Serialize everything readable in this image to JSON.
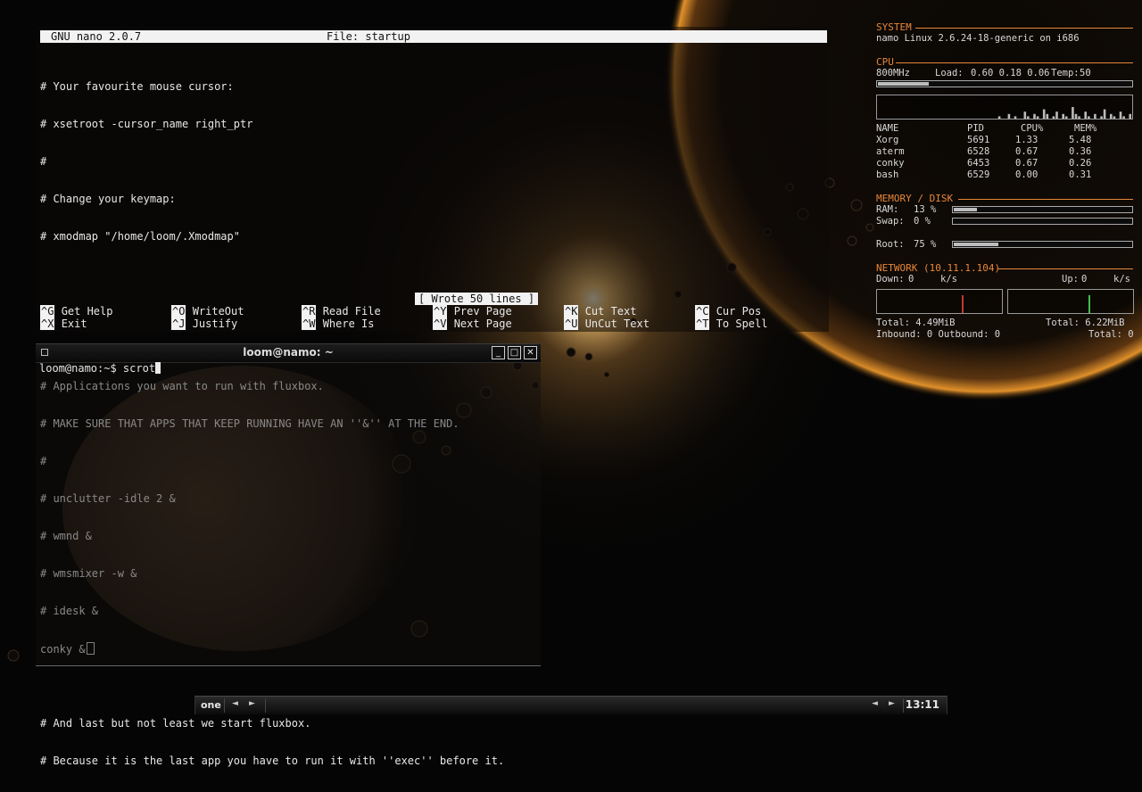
{
  "nano": {
    "version": "GNU nano 2.0.7",
    "file_title": "File: startup",
    "lines": [
      "# Your favourite mouse cursor:",
      "# xsetroot -cursor_name right_ptr",
      "#",
      "# Change your keymap:",
      "# xmodmap \"/home/loom/.Xmodmap\"",
      "",
      "",
      "",
      "# Applications you want to run with fluxbox.",
      "# MAKE SURE THAT APPS THAT KEEP RUNNING HAVE AN ''&'' AT THE END.",
      "#",
      "# unclutter -idle 2 &",
      "# wmnd &",
      "# wmsmixer -w &",
      "# idesk &",
      "conky &",
      "",
      "# And last but not least we start fluxbox.",
      "# Because it is the last app you have to run it with ''exec'' before it."
    ],
    "status_message": "[ Wrote 50 lines ]",
    "shortcuts": [
      {
        "key": "^G",
        "label": "Get Help"
      },
      {
        "key": "^O",
        "label": "WriteOut"
      },
      {
        "key": "^R",
        "label": "Read File"
      },
      {
        "key": "^Y",
        "label": "Prev Page"
      },
      {
        "key": "^K",
        "label": "Cut Text"
      },
      {
        "key": "^C",
        "label": "Cur Pos"
      },
      {
        "key": "^X",
        "label": "Exit"
      },
      {
        "key": "^J",
        "label": "Justify"
      },
      {
        "key": "^W",
        "label": "Where Is"
      },
      {
        "key": "^V",
        "label": "Next Page"
      },
      {
        "key": "^U",
        "label": "UnCut Text"
      },
      {
        "key": "^T",
        "label": "To Spell"
      }
    ]
  },
  "xterm": {
    "title": "loom@namo: ~",
    "prompt": "loom@namo:~$ ",
    "command": "scrot",
    "buttons": {
      "minimize": "_",
      "maximize": "□",
      "close": "✕"
    }
  },
  "conky": {
    "system": {
      "header": "SYSTEM",
      "info": "namo Linux 2.6.24-18-generic on i686"
    },
    "cpu": {
      "header": "CPU",
      "freq": "800MHz",
      "load_label": "Load:",
      "load_values": "0.60 0.18 0.06",
      "temp_label": "Temp:",
      "temp_value": "50",
      "usage_fraction": 0.2,
      "graph_values": [
        0,
        0,
        0,
        0,
        0,
        0,
        0,
        0,
        0,
        0,
        0,
        0,
        0,
        0,
        0,
        0,
        0,
        0,
        0,
        0,
        0,
        0,
        0,
        0,
        0,
        0,
        0,
        0,
        0,
        0,
        0,
        0,
        0,
        0,
        0,
        0,
        0,
        0,
        1,
        0,
        0,
        2,
        0,
        1,
        0,
        0,
        3,
        1,
        0,
        2,
        1,
        0,
        4,
        2,
        0,
        1,
        3,
        0,
        2,
        1,
        0,
        5,
        2,
        1,
        0,
        3,
        1,
        0,
        2,
        0,
        1,
        4,
        0,
        2,
        1,
        0,
        3,
        1,
        0,
        2
      ]
    },
    "processes": {
      "columns": [
        "NAME",
        "PID",
        "CPU%",
        "MEM%"
      ],
      "rows": [
        [
          "Xorg",
          "5691",
          "1.33",
          "5.48"
        ],
        [
          "aterm",
          "6528",
          "0.67",
          "0.36"
        ],
        [
          "conky",
          "6453",
          "0.67",
          "0.26"
        ],
        [
          "bash",
          "6529",
          "0.00",
          "0.31"
        ]
      ]
    },
    "memory": {
      "header": "MEMORY / DISK",
      "ram_label": "RAM:",
      "ram_value": "13 %",
      "ram_fraction": 0.13,
      "swap_label": "Swap:",
      "swap_value": "0 %",
      "swap_fraction": 0.0,
      "root_label": "Root:",
      "root_value": "75 %",
      "root_fraction": 0.25
    },
    "network": {
      "header": "NETWORK (10.11.1.104)",
      "down_label": "Down:",
      "down_value": "0",
      "down_unit": "k/s",
      "up_label": "Up:",
      "up_value": "0",
      "up_unit": "k/s",
      "total_down": "Total: 4.49MiB",
      "total_up": "Total: 6.22MiB",
      "inbound": "Inbound: 0 Outbound: 0",
      "total_conn": "Total: 0"
    },
    "colors": {
      "accent": "#e8873a",
      "text": "#d8d8d8",
      "down_graph": "#c0392b",
      "up_graph": "#3fbf4f"
    }
  },
  "taskbar": {
    "workspace": "one",
    "clock": "13:11",
    "left_arrow": "◄",
    "right_arrow": "►"
  }
}
